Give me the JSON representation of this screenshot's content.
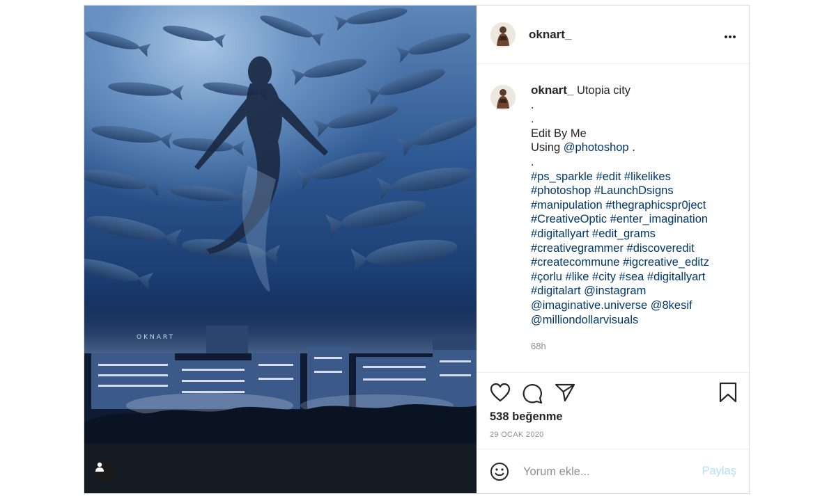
{
  "post": {
    "username": "oknart_",
    "more_label": "•••",
    "image_watermark": "OKNART",
    "caption": {
      "username": "oknart_",
      "title": "Utopia city",
      "dot1": ".",
      "dot2": ".",
      "line_edit": "Edit By Me",
      "line_using_prefix": "Using ",
      "line_using_mention": "@photoshop",
      "line_using_suffix": " .",
      "dot3": ".",
      "tag_lines": [
        "#ps_sparkle #edit #likelikes",
        "#photoshop #LaunchDsigns",
        "#manipulation #thegraphicspr0ject",
        "#CreativeOptic #enter_imagination",
        "#digitallyart #edit_grams",
        "#creativegrammer #discoveredit",
        "#createcommune #igcreative_editz",
        "#çorlu #like #city #sea #digitallyart",
        "#digitalart @instagram",
        "@imaginative.universe @8kesif",
        "@milliondollarvisuals"
      ]
    },
    "time_ago": "68h",
    "likes_text": "538 beğenme",
    "date_text": "29 OCAK 2020",
    "comment_placeholder": "Yorum ekle...",
    "share_label": "Paylaş",
    "colors": {
      "link": "#00376b",
      "muted": "#8e8e8e",
      "share_disabled": "#b2dffc",
      "border": "#dbdbdb"
    },
    "icons": [
      "heart-icon",
      "comment-icon",
      "share-icon",
      "bookmark-icon",
      "emoji-icon",
      "user-tag-icon"
    ]
  }
}
